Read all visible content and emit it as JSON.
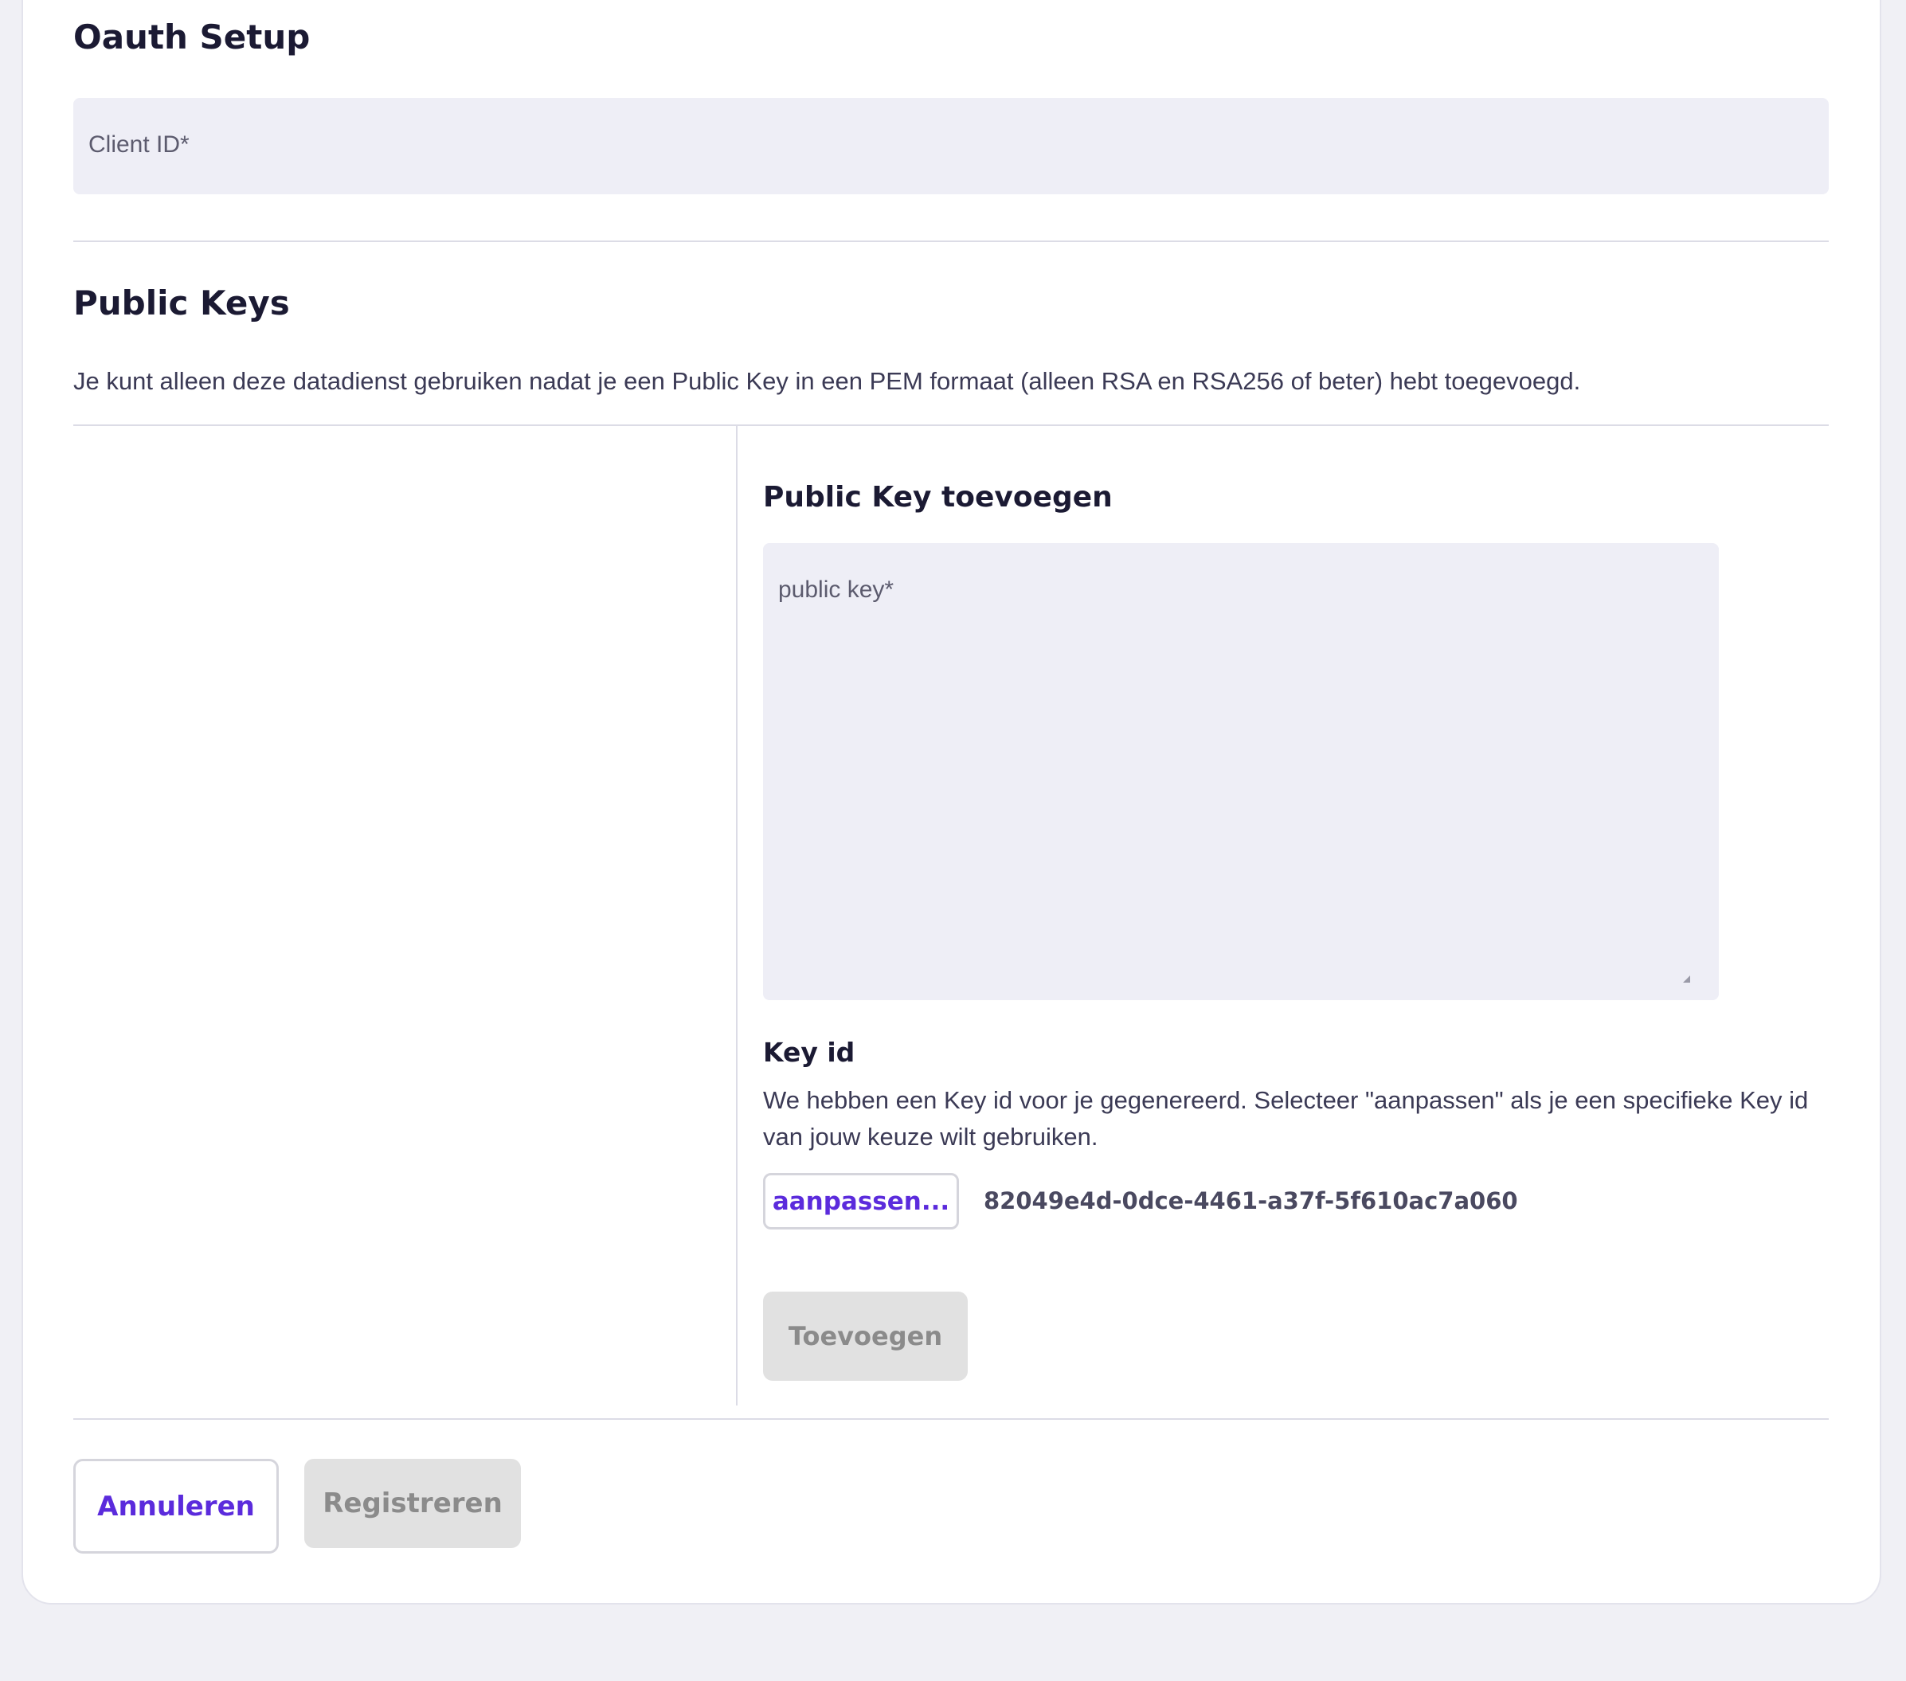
{
  "oauth": {
    "title": "Oauth Setup",
    "client_id_placeholder": "Client ID*"
  },
  "public_keys": {
    "title": "Public Keys",
    "description": "Je kunt alleen deze datadienst gebruiken nadat je een Public Key in een PEM formaat (alleen RSA en RSA256 of beter) hebt toegevoegd."
  },
  "add_key": {
    "title": "Public Key toevoegen",
    "public_key_placeholder": "public key*",
    "key_id_title": "Key id",
    "key_id_description": "We hebben een Key id voor je gegenereerd. Selecteer \"aanpassen\" als je een specifieke Key id van jouw keuze wilt gebruiken.",
    "edit_button": "aanpassen...",
    "key_id_value": "82049e4d-0dce-4461-a37f-5f610ac7a060",
    "add_button": "Toevoegen"
  },
  "footer": {
    "cancel_button": "Annuleren",
    "register_button": "Registreren"
  },
  "colors": {
    "accent": "#5b2bdc",
    "field_bg": "#eeeef6",
    "disabled_bg": "#e1e1e1",
    "page_bg": "#f0f0f5"
  }
}
